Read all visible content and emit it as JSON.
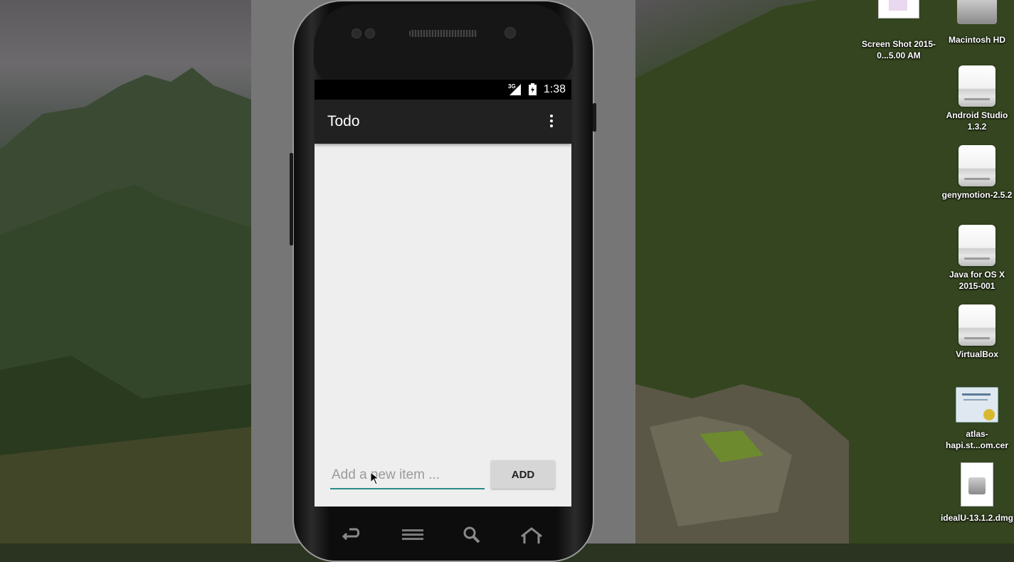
{
  "emulator": {
    "status_bar": {
      "network": "3G",
      "time": "1:38"
    },
    "app_bar": {
      "title": "Todo",
      "menu_icon": "overflow-menu-icon"
    },
    "input": {
      "placeholder": "Add a new item ...",
      "value": ""
    },
    "add_button": {
      "label": "ADD"
    },
    "nav_icons": [
      "back-icon",
      "menu-icon",
      "search-icon",
      "home-icon"
    ],
    "colors": {
      "app_bar": "#212121",
      "accent": "#2a8c86",
      "screen_bg": "#eeeeee"
    }
  },
  "desktop": {
    "icons": [
      {
        "name": "screenshot-file",
        "label": "Screen Shot 2015-0...5.00 AM",
        "icon": "image-file-icon"
      },
      {
        "name": "macintosh-hd",
        "label": "Macintosh HD",
        "icon": "hard-drive-icon"
      },
      {
        "name": "android-studio",
        "label": "Android Studio 1.3.2",
        "icon": "disk-image-icon"
      },
      {
        "name": "genymotion",
        "label": "genymotion-2.5.2",
        "icon": "disk-image-icon"
      },
      {
        "name": "java-osx",
        "label": "Java for OS X 2015-001",
        "icon": "disk-image-icon"
      },
      {
        "name": "virtualbox",
        "label": "VirtualBox",
        "icon": "disk-image-icon"
      },
      {
        "name": "atlas-cert",
        "label": "atlas-hapi.st...om.cer",
        "icon": "certificate-icon"
      },
      {
        "name": "idealu-dmg",
        "label": "idealU-13.1.2.dmg",
        "icon": "dmg-file-icon"
      }
    ]
  }
}
